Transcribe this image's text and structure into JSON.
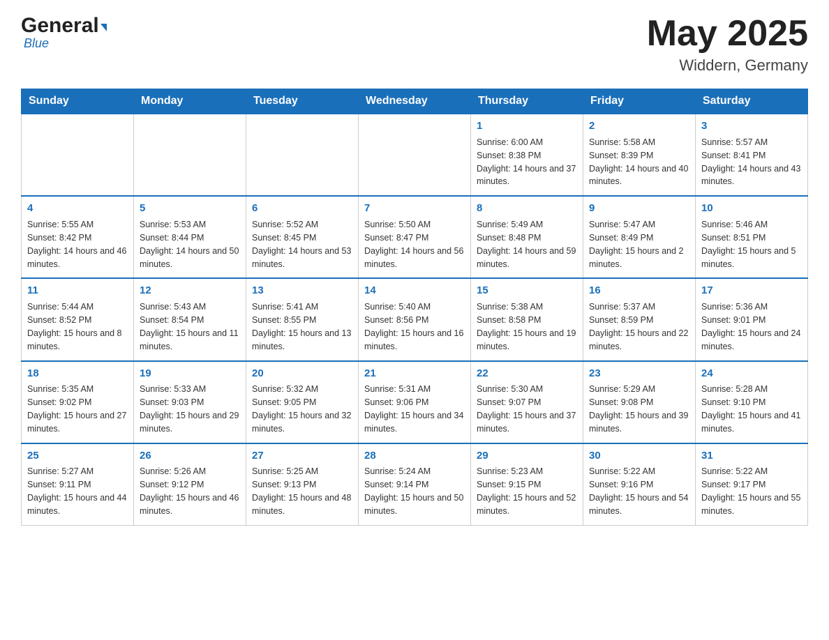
{
  "header": {
    "logo_general": "General",
    "logo_blue": "Blue",
    "title": "May 2025",
    "location": "Widdern, Germany"
  },
  "weekdays": [
    "Sunday",
    "Monday",
    "Tuesday",
    "Wednesday",
    "Thursday",
    "Friday",
    "Saturday"
  ],
  "weeks": [
    [
      {
        "day": "",
        "info": ""
      },
      {
        "day": "",
        "info": ""
      },
      {
        "day": "",
        "info": ""
      },
      {
        "day": "",
        "info": ""
      },
      {
        "day": "1",
        "info": "Sunrise: 6:00 AM\nSunset: 8:38 PM\nDaylight: 14 hours and 37 minutes."
      },
      {
        "day": "2",
        "info": "Sunrise: 5:58 AM\nSunset: 8:39 PM\nDaylight: 14 hours and 40 minutes."
      },
      {
        "day": "3",
        "info": "Sunrise: 5:57 AM\nSunset: 8:41 PM\nDaylight: 14 hours and 43 minutes."
      }
    ],
    [
      {
        "day": "4",
        "info": "Sunrise: 5:55 AM\nSunset: 8:42 PM\nDaylight: 14 hours and 46 minutes."
      },
      {
        "day": "5",
        "info": "Sunrise: 5:53 AM\nSunset: 8:44 PM\nDaylight: 14 hours and 50 minutes."
      },
      {
        "day": "6",
        "info": "Sunrise: 5:52 AM\nSunset: 8:45 PM\nDaylight: 14 hours and 53 minutes."
      },
      {
        "day": "7",
        "info": "Sunrise: 5:50 AM\nSunset: 8:47 PM\nDaylight: 14 hours and 56 minutes."
      },
      {
        "day": "8",
        "info": "Sunrise: 5:49 AM\nSunset: 8:48 PM\nDaylight: 14 hours and 59 minutes."
      },
      {
        "day": "9",
        "info": "Sunrise: 5:47 AM\nSunset: 8:49 PM\nDaylight: 15 hours and 2 minutes."
      },
      {
        "day": "10",
        "info": "Sunrise: 5:46 AM\nSunset: 8:51 PM\nDaylight: 15 hours and 5 minutes."
      }
    ],
    [
      {
        "day": "11",
        "info": "Sunrise: 5:44 AM\nSunset: 8:52 PM\nDaylight: 15 hours and 8 minutes."
      },
      {
        "day": "12",
        "info": "Sunrise: 5:43 AM\nSunset: 8:54 PM\nDaylight: 15 hours and 11 minutes."
      },
      {
        "day": "13",
        "info": "Sunrise: 5:41 AM\nSunset: 8:55 PM\nDaylight: 15 hours and 13 minutes."
      },
      {
        "day": "14",
        "info": "Sunrise: 5:40 AM\nSunset: 8:56 PM\nDaylight: 15 hours and 16 minutes."
      },
      {
        "day": "15",
        "info": "Sunrise: 5:38 AM\nSunset: 8:58 PM\nDaylight: 15 hours and 19 minutes."
      },
      {
        "day": "16",
        "info": "Sunrise: 5:37 AM\nSunset: 8:59 PM\nDaylight: 15 hours and 22 minutes."
      },
      {
        "day": "17",
        "info": "Sunrise: 5:36 AM\nSunset: 9:01 PM\nDaylight: 15 hours and 24 minutes."
      }
    ],
    [
      {
        "day": "18",
        "info": "Sunrise: 5:35 AM\nSunset: 9:02 PM\nDaylight: 15 hours and 27 minutes."
      },
      {
        "day": "19",
        "info": "Sunrise: 5:33 AM\nSunset: 9:03 PM\nDaylight: 15 hours and 29 minutes."
      },
      {
        "day": "20",
        "info": "Sunrise: 5:32 AM\nSunset: 9:05 PM\nDaylight: 15 hours and 32 minutes."
      },
      {
        "day": "21",
        "info": "Sunrise: 5:31 AM\nSunset: 9:06 PM\nDaylight: 15 hours and 34 minutes."
      },
      {
        "day": "22",
        "info": "Sunrise: 5:30 AM\nSunset: 9:07 PM\nDaylight: 15 hours and 37 minutes."
      },
      {
        "day": "23",
        "info": "Sunrise: 5:29 AM\nSunset: 9:08 PM\nDaylight: 15 hours and 39 minutes."
      },
      {
        "day": "24",
        "info": "Sunrise: 5:28 AM\nSunset: 9:10 PM\nDaylight: 15 hours and 41 minutes."
      }
    ],
    [
      {
        "day": "25",
        "info": "Sunrise: 5:27 AM\nSunset: 9:11 PM\nDaylight: 15 hours and 44 minutes."
      },
      {
        "day": "26",
        "info": "Sunrise: 5:26 AM\nSunset: 9:12 PM\nDaylight: 15 hours and 46 minutes."
      },
      {
        "day": "27",
        "info": "Sunrise: 5:25 AM\nSunset: 9:13 PM\nDaylight: 15 hours and 48 minutes."
      },
      {
        "day": "28",
        "info": "Sunrise: 5:24 AM\nSunset: 9:14 PM\nDaylight: 15 hours and 50 minutes."
      },
      {
        "day": "29",
        "info": "Sunrise: 5:23 AM\nSunset: 9:15 PM\nDaylight: 15 hours and 52 minutes."
      },
      {
        "day": "30",
        "info": "Sunrise: 5:22 AM\nSunset: 9:16 PM\nDaylight: 15 hours and 54 minutes."
      },
      {
        "day": "31",
        "info": "Sunrise: 5:22 AM\nSunset: 9:17 PM\nDaylight: 15 hours and 55 minutes."
      }
    ]
  ]
}
